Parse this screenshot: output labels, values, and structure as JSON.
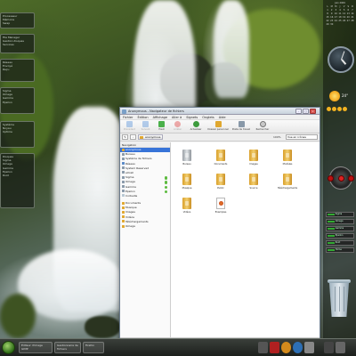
{
  "window": {
    "title": "Anonymous - Navigateur de fichiers",
    "menu": [
      "Fichier",
      "Édition",
      "Affichage",
      "Aller à",
      "Signets",
      "Onglets",
      "Aide"
    ],
    "toolbar": [
      {
        "label": "Précédent",
        "icon": "back-arrow-icon"
      },
      {
        "label": "Suivant",
        "icon": "forward-arrow-icon"
      },
      {
        "label": "Haut",
        "icon": "up-arrow-icon"
      },
      {
        "label": "Arrêter",
        "icon": "stop-icon"
      },
      {
        "label": "Actualiser",
        "icon": "refresh-icon"
      },
      {
        "label": "Dossier personnel",
        "icon": "home-icon"
      },
      {
        "label": "Poste de travail",
        "icon": "computer-icon"
      },
      {
        "label": "Rechercher",
        "icon": "search-icon"
      }
    ],
    "location": "anonymous",
    "zoom": "100%",
    "view_mode": "Vue en icônes",
    "sidebar_header": "Navigation",
    "places": [
      {
        "label": "anonymous",
        "selected": true
      },
      {
        "label": "Bureau"
      },
      {
        "label": "Système de fichiers"
      },
      {
        "label": "Réseau"
      },
      {
        "label": "System Reserved"
      },
      {
        "label": "eXcell"
      },
      {
        "label": "Sigma",
        "eject": true
      },
      {
        "label": "Omega",
        "eject": true
      },
      {
        "label": "Gamma",
        "eject": true
      },
      {
        "label": "Epsilon",
        "eject": true
      },
      {
        "label": "Corbeille"
      }
    ],
    "bookmarks": [
      "Documents",
      "Musique",
      "Images",
      "Vidéos",
      "Téléchargements",
      "Omega"
    ],
    "files": [
      "Bureau",
      "Documents",
      "Images",
      "Modèles",
      "Musique",
      "Public",
      "Source",
      "Téléchargements",
      "Vidéos",
      "Examples"
    ],
    "status": "10 éléments, espace libre : 210,8 Go"
  },
  "taskbar": {
    "tasks": [
      "Éditeur d'image GIMP",
      "Gestionnaire de fichiers",
      "Firefox"
    ]
  },
  "left_widgets": [
    [
      "Processeur",
      "Mémoire",
      "Swap"
    ],
    [
      "File Manager",
      "Gestion disques",
      "Services"
    ],
    [
      "Réseau",
      "Envoyé",
      "Reçu"
    ],
    [
      "Sigma",
      "Omega",
      "Gamma",
      "Epsilon"
    ],
    [
      "Système",
      "Noyau",
      "Uptime"
    ],
    [
      "Disques",
      "Sigma",
      "Omega",
      "Gamma",
      "Epsilon",
      "Root"
    ]
  ],
  "calendar": {
    "month": "Juin 2009",
    "days": [
      "L",
      "M",
      "M",
      "J",
      "V",
      "S",
      "D"
    ],
    "dates": [
      "1",
      "2",
      "3",
      "4",
      "5",
      "6",
      "7",
      "8",
      "9",
      "10",
      "11",
      "12",
      "13",
      "14",
      "15",
      "16",
      "17",
      "18",
      "19",
      "20",
      "21",
      "22",
      "23",
      "24",
      "25",
      "26",
      "27",
      "28",
      "29",
      "30"
    ]
  },
  "weather": {
    "temperature": "24°"
  },
  "devices": [
    "Sigma",
    "Omega",
    "Gamma",
    "Epsilon",
    "Root",
    "Home"
  ]
}
